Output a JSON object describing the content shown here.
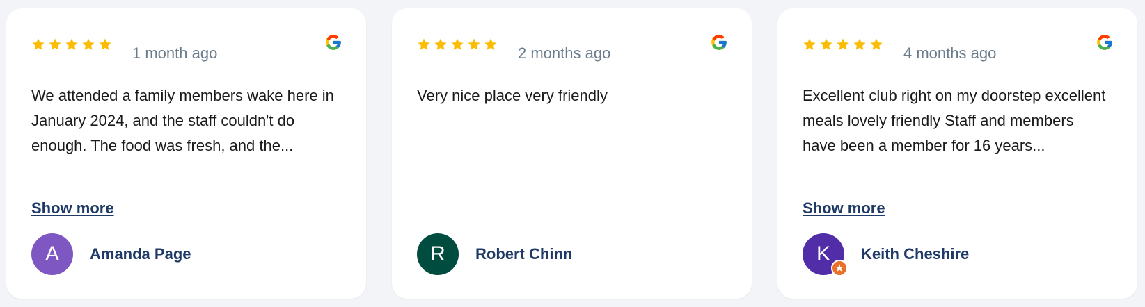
{
  "colors": {
    "star": "#fbbc04",
    "link": "#1f3a66",
    "muted": "#6b7c8c",
    "badge": "#e8702a"
  },
  "reviews": [
    {
      "rating": 5,
      "date": "1 month ago",
      "text": "We attended a family members wake here in January 2024, and the staff couldn't do enough. The food was fresh, and the...",
      "show_more": "Show more",
      "initial": "A",
      "name": "Amanda Page",
      "avatar_color": "#7e57c2",
      "icon": "google-icon"
    },
    {
      "rating": 5,
      "date": "2 months ago",
      "text": "Very nice place very friendly",
      "initial": "R",
      "name": "Robert Chinn",
      "avatar_color": "#004d40",
      "icon": "google-icon"
    },
    {
      "rating": 5,
      "date": "4 months ago",
      "text": "Excellent club right on my doorstep excellent meals lovely friendly Staff and members have been a member for 16 years...",
      "show_more": "Show more",
      "initial": "K",
      "name": "Keith Cheshire",
      "avatar_color": "#512da8",
      "icon": "google-icon",
      "badge_icon": "local-guide-badge-icon"
    }
  ]
}
